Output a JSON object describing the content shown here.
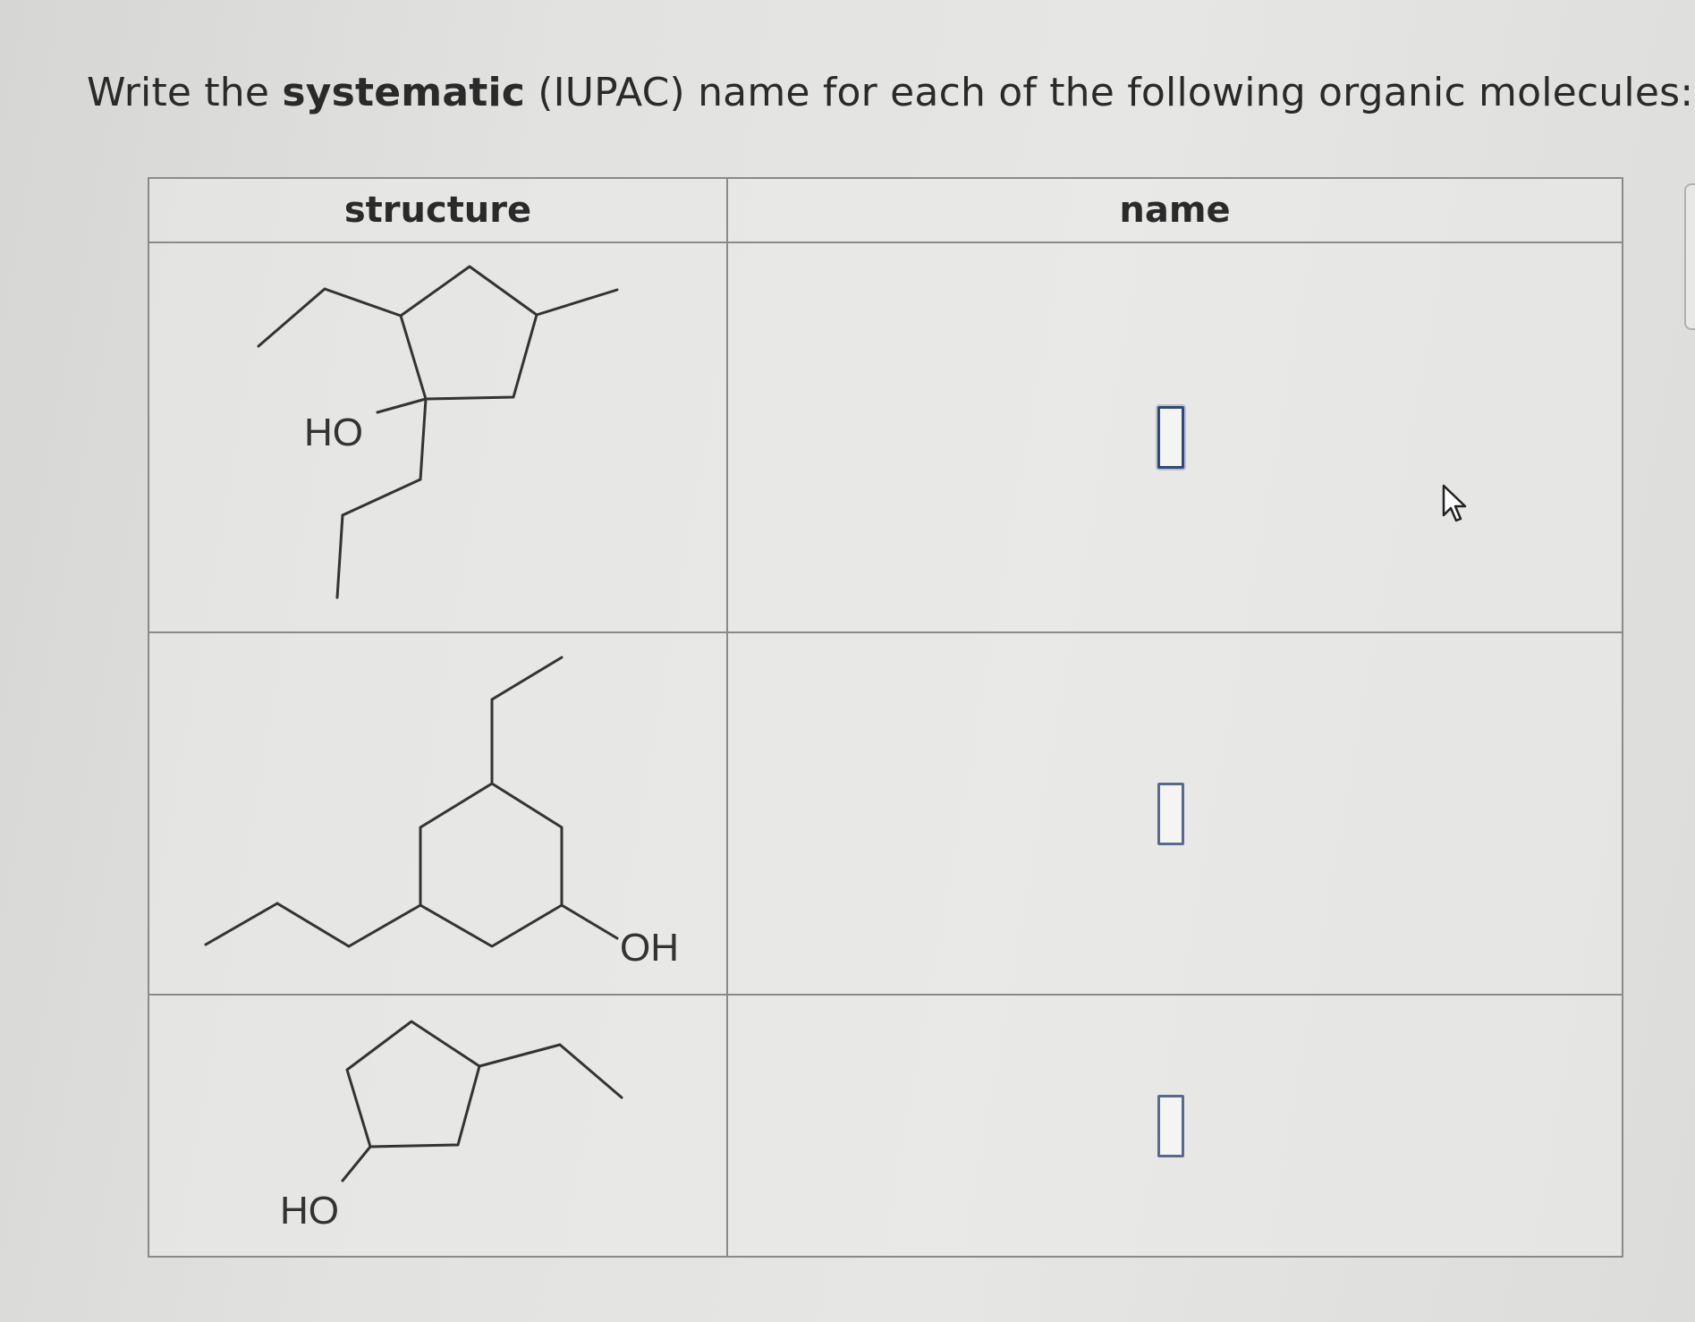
{
  "prompt": {
    "prefix": "Write the ",
    "emphasis": "systematic",
    "suffix": " (IUPAC) name for each of the following organic molecules:"
  },
  "table": {
    "headers": {
      "structure": "structure",
      "name": "name"
    },
    "rows": [
      {
        "structure_label": "HO",
        "name_value": ""
      },
      {
        "structure_label": "OH",
        "name_value": ""
      },
      {
        "structure_label": "HO",
        "name_value": ""
      }
    ]
  },
  "icons": {
    "cursor": "mouse-pointer-icon"
  }
}
